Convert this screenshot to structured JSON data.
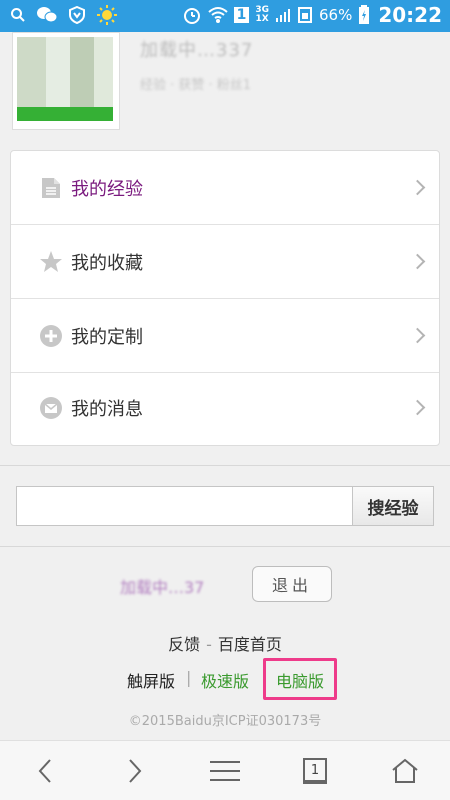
{
  "status_bar": {
    "network": "3G",
    "network2": "1X",
    "sim": "1",
    "battery": "66%",
    "time": "20:22"
  },
  "profile": {
    "username": "加载中…337",
    "subtitle": "经验 · 获赞 · 粉丝1"
  },
  "menu": {
    "items": [
      {
        "label": "我的经验",
        "icon": "document-icon"
      },
      {
        "label": "我的收藏",
        "icon": "star-icon"
      },
      {
        "label": "我的定制",
        "icon": "plus-circle-icon"
      },
      {
        "label": "我的消息",
        "icon": "mail-icon"
      }
    ]
  },
  "search": {
    "value": "",
    "placeholder": "",
    "button_label": "搜经验"
  },
  "footer": {
    "username": "加载中…37",
    "logout_label": "退出",
    "feedback": "反馈",
    "sep": "-",
    "home": "百度首页",
    "touch": "触屏版",
    "fast": "极速版",
    "pc": "电脑版",
    "bar": "|",
    "copyright": "©2015Baidu京ICP证030173号"
  },
  "bottom_nav": {
    "tab_count": "1"
  },
  "colors": {
    "status_bar": "#2f9de0",
    "active_menu": "#7a1a7e",
    "link_green": "#3a9a2e",
    "highlight": "#ee3b8a"
  }
}
